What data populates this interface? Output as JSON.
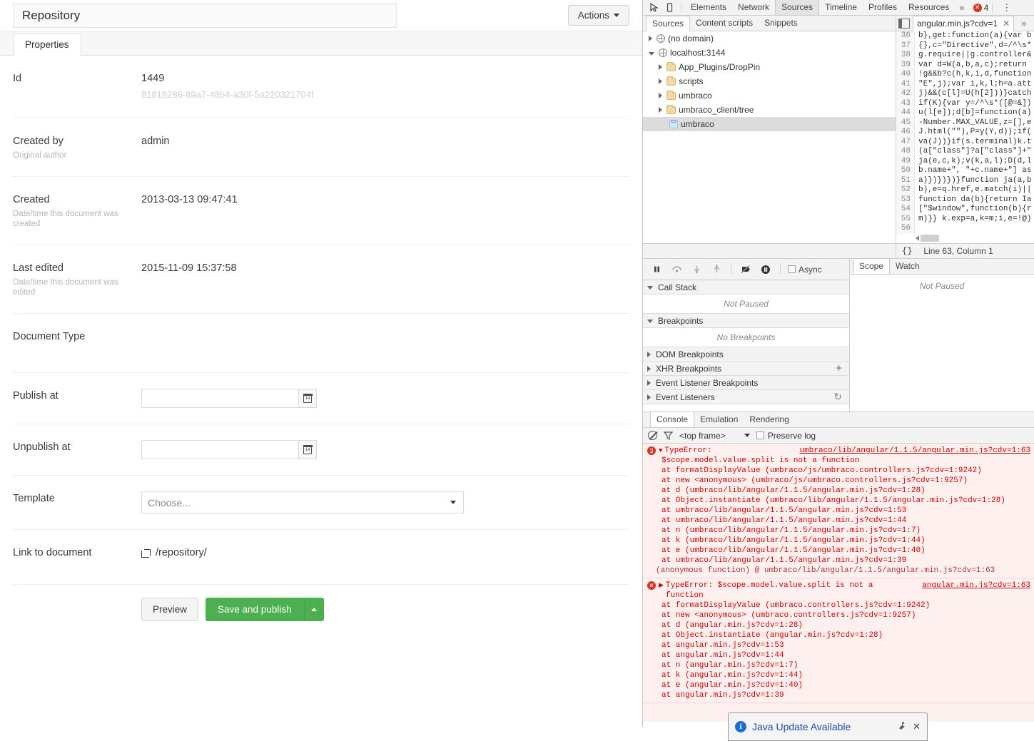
{
  "umbraco": {
    "document_title": "Repository",
    "actions_label": "Actions",
    "tabs": [
      {
        "label": "Properties",
        "active": true
      }
    ],
    "properties": [
      {
        "label": "Id",
        "description": "",
        "value": "1449",
        "guid": "81818286-89a7-48b4-a30f-5a220321704f",
        "type": "text"
      },
      {
        "label": "Created by",
        "description": "Original author",
        "value": "admin",
        "type": "text"
      },
      {
        "label": "Created",
        "description": "Date/time this document was created",
        "value": "2013-03-13 09:47:41",
        "type": "text"
      },
      {
        "label": "Last edited",
        "description": "Date/time this document was edited",
        "value": "2015-11-09 15:37:58",
        "type": "text"
      },
      {
        "label": "Document Type",
        "description": "",
        "value": "",
        "type": "text"
      },
      {
        "label": "Publish at",
        "description": "",
        "value": "",
        "placeholder": "",
        "type": "date"
      },
      {
        "label": "Unpublish at",
        "description": "",
        "value": "",
        "placeholder": "",
        "type": "date"
      },
      {
        "label": "Template",
        "description": "",
        "value": "Choose...",
        "type": "select"
      },
      {
        "label": "Link to document",
        "description": "",
        "value": "/repository/",
        "type": "link"
      }
    ],
    "footer": {
      "preview_label": "Preview",
      "publish_label": "Save and publish"
    }
  },
  "devtools": {
    "main_tabs": [
      "Elements",
      "Network",
      "Sources",
      "Timeline",
      "Profiles",
      "Resources"
    ],
    "active_main_tab": "Sources",
    "overflow_label": "»",
    "error_count": "4",
    "error_badge_glyph": "✕",
    "kebab_glyph": "⋮",
    "sub_tabs": [
      "Sources",
      "Content scripts",
      "Snippets"
    ],
    "active_sub_tab": "Sources",
    "file_tab": {
      "name": "angular.min.js?cdv=1",
      "close_glyph": "✕"
    },
    "file_overflow": "»",
    "tree": [
      {
        "label": "(no domain)",
        "icon": "globe-icon",
        "indent": 0,
        "expanded": false,
        "selected": false
      },
      {
        "label": "localhost:3144",
        "icon": "globe-icon",
        "indent": 0,
        "expanded": true,
        "selected": false
      },
      {
        "label": "App_Plugins/DropPin",
        "icon": "folder-icon",
        "indent": 1,
        "expanded": false,
        "selected": false
      },
      {
        "label": "scripts",
        "icon": "folder-icon",
        "indent": 1,
        "expanded": false,
        "selected": false
      },
      {
        "label": "umbraco",
        "icon": "folder-icon",
        "indent": 1,
        "expanded": false,
        "selected": false
      },
      {
        "label": "umbraco_client/tree",
        "icon": "folder-icon",
        "indent": 1,
        "expanded": false,
        "selected": false
      },
      {
        "label": "umbraco",
        "icon": "js-file-icon",
        "indent": 2,
        "expanded": null,
        "selected": true
      }
    ],
    "code_lines": [
      {
        "n": "36",
        "t": "b},get:function(a){var b"
      },
      {
        "n": "37",
        "t": "{},c=\"Directive\",d=/^\\s*"
      },
      {
        "n": "38",
        "t": "g.require||g.controller&"
      },
      {
        "n": "39",
        "t": "var d=W(a,b,a,c);return "
      },
      {
        "n": "40",
        "t": "!g&&b?c(h,k,i,d,function"
      },
      {
        "n": "41",
        "t": "\"E\",j);var i,k,l;h=a.att"
      },
      {
        "n": "42",
        "t": "j)&&(c[l]=U(h[2]))}catch"
      },
      {
        "n": "43",
        "t": "if(K){var y=/^\\s*([@=&])"
      },
      {
        "n": "44",
        "t": "u(l[e]);d[b]=function(a)"
      },
      {
        "n": "45",
        "t": "-Number.MAX_VALUE,z=[],e"
      },
      {
        "n": "46",
        "t": "J.html(\"\"),P=y(Y,d));if("
      },
      {
        "n": "47",
        "t": "va(J))}if(s.terminal)k.t"
      },
      {
        "n": "48",
        "t": "(a[\"class\"]?a[\"class\"]+\""
      },
      {
        "n": "49",
        "t": "ja(e,c,k);v(k,a,l);D(d,l"
      },
      {
        "n": "50",
        "t": "b.name+\", \"+c.name+\"] as"
      },
      {
        "n": "51",
        "t": "a)})})})}function ja(a,b"
      },
      {
        "n": "52",
        "t": "b),e=q.href,e.match(i)||"
      },
      {
        "n": "53",
        "t": "function da(b){return Ia"
      },
      {
        "n": "54",
        "t": "[\"$window\",function(b){r"
      },
      {
        "n": "55",
        "t": "m)}} k.exp=a,k=m;i,e=!@)"
      },
      {
        "n": "56",
        "t": ""
      }
    ],
    "status": {
      "pretty_print": "{}",
      "position": "Line 63, Column 1"
    },
    "debugger": {
      "buttons": [
        "pause-resume",
        "step-over",
        "step-into",
        "step-out",
        "deactivate-breakpoints",
        "pause-on-exceptions"
      ],
      "async_label": "Async",
      "sections": [
        {
          "title": "Call Stack",
          "expanded": true,
          "empty_text": "Not Paused",
          "action": null
        },
        {
          "title": "Breakpoints",
          "expanded": true,
          "empty_text": "No Breakpoints",
          "action": null
        },
        {
          "title": "DOM Breakpoints",
          "expanded": false,
          "empty_text": null,
          "action": null
        },
        {
          "title": "XHR Breakpoints",
          "expanded": false,
          "empty_text": null,
          "action": "+"
        },
        {
          "title": "Event Listener Breakpoints",
          "expanded": false,
          "empty_text": null,
          "action": null
        },
        {
          "title": "Event Listeners",
          "expanded": false,
          "empty_text": null,
          "action": "↻"
        }
      ],
      "scope_tabs": [
        "Scope",
        "Watch"
      ],
      "active_scope_tab": "Scope",
      "scope_empty": "Not Paused"
    },
    "console": {
      "tabs": [
        "Console",
        "Emulation",
        "Rendering"
      ],
      "active_tab": "Console",
      "frame_selector": "<top frame>",
      "preserve_log_label": "Preserve log",
      "clear_icon": "clear-console-icon",
      "filter_icon": "filter-icon",
      "messages": [
        {
          "badge": "3",
          "kind": "grouped-error",
          "expanded": true,
          "title": "TypeError:",
          "source": "umbraco/lib/angular/1.1.5/angular.min.js?cdv=1:63",
          "detail": "$scope.model.value.split is not a function",
          "frames": [
            "at formatDisplayValue (umbraco/js/umbraco.controllers.js?cdv=1:9242)",
            "at new <anonymous> (umbraco/js/umbraco.controllers.js?cdv=1:9257)",
            "at d (umbraco/lib/angular/1.1.5/angular.min.js?cdv=1:28)",
            "at Object.instantiate (umbraco/lib/angular/1.1.5/angular.min.js?cdv=1:28)",
            "at umbraco/lib/angular/1.1.5/angular.min.js?cdv=1:53",
            "at umbraco/lib/angular/1.1.5/angular.min.js?cdv=1:44",
            "at n (umbraco/lib/angular/1.1.5/angular.min.js?cdv=1:7)",
            "at k (umbraco/lib/angular/1.1.5/angular.min.js?cdv=1:44)",
            "at e (umbraco/lib/angular/1.1.5/angular.min.js?cdv=1:40)",
            "at umbraco/lib/angular/1.1.5/angular.min.js?cdv=1:39"
          ],
          "anonymous_line": "(anonymous function) @ umbraco/lib/angular/1.1.5/angular.min.js?cdv=1:63"
        },
        {
          "badge": "",
          "kind": "error",
          "expanded": false,
          "title": "TypeError: $scope.model.value.split is not a function",
          "source": "angular.min.js?cdv=1:63",
          "detail": "",
          "frames": [
            "at formatDisplayValue (umbraco.controllers.js?cdv=1:9242)",
            "at new <anonymous> (umbraco.controllers.js?cdv=1:9257)",
            "at d (angular.min.js?cdv=1:28)",
            "at Object.instantiate (angular.min.js?cdv=1:28)",
            "at angular.min.js?cdv=1:53",
            "at angular.min.js?cdv=1:44",
            "at n (angular.min.js?cdv=1:7)",
            "at k (angular.min.js?cdv=1:44)",
            "at e (angular.min.js?cdv=1:40)",
            "at angular.min.js?cdv=1:39"
          ],
          "anonymous_line": ""
        }
      ]
    }
  },
  "java_popup": {
    "title": "Java Update Available",
    "wrench_glyph": "🔧",
    "close_glyph": "✕"
  }
}
